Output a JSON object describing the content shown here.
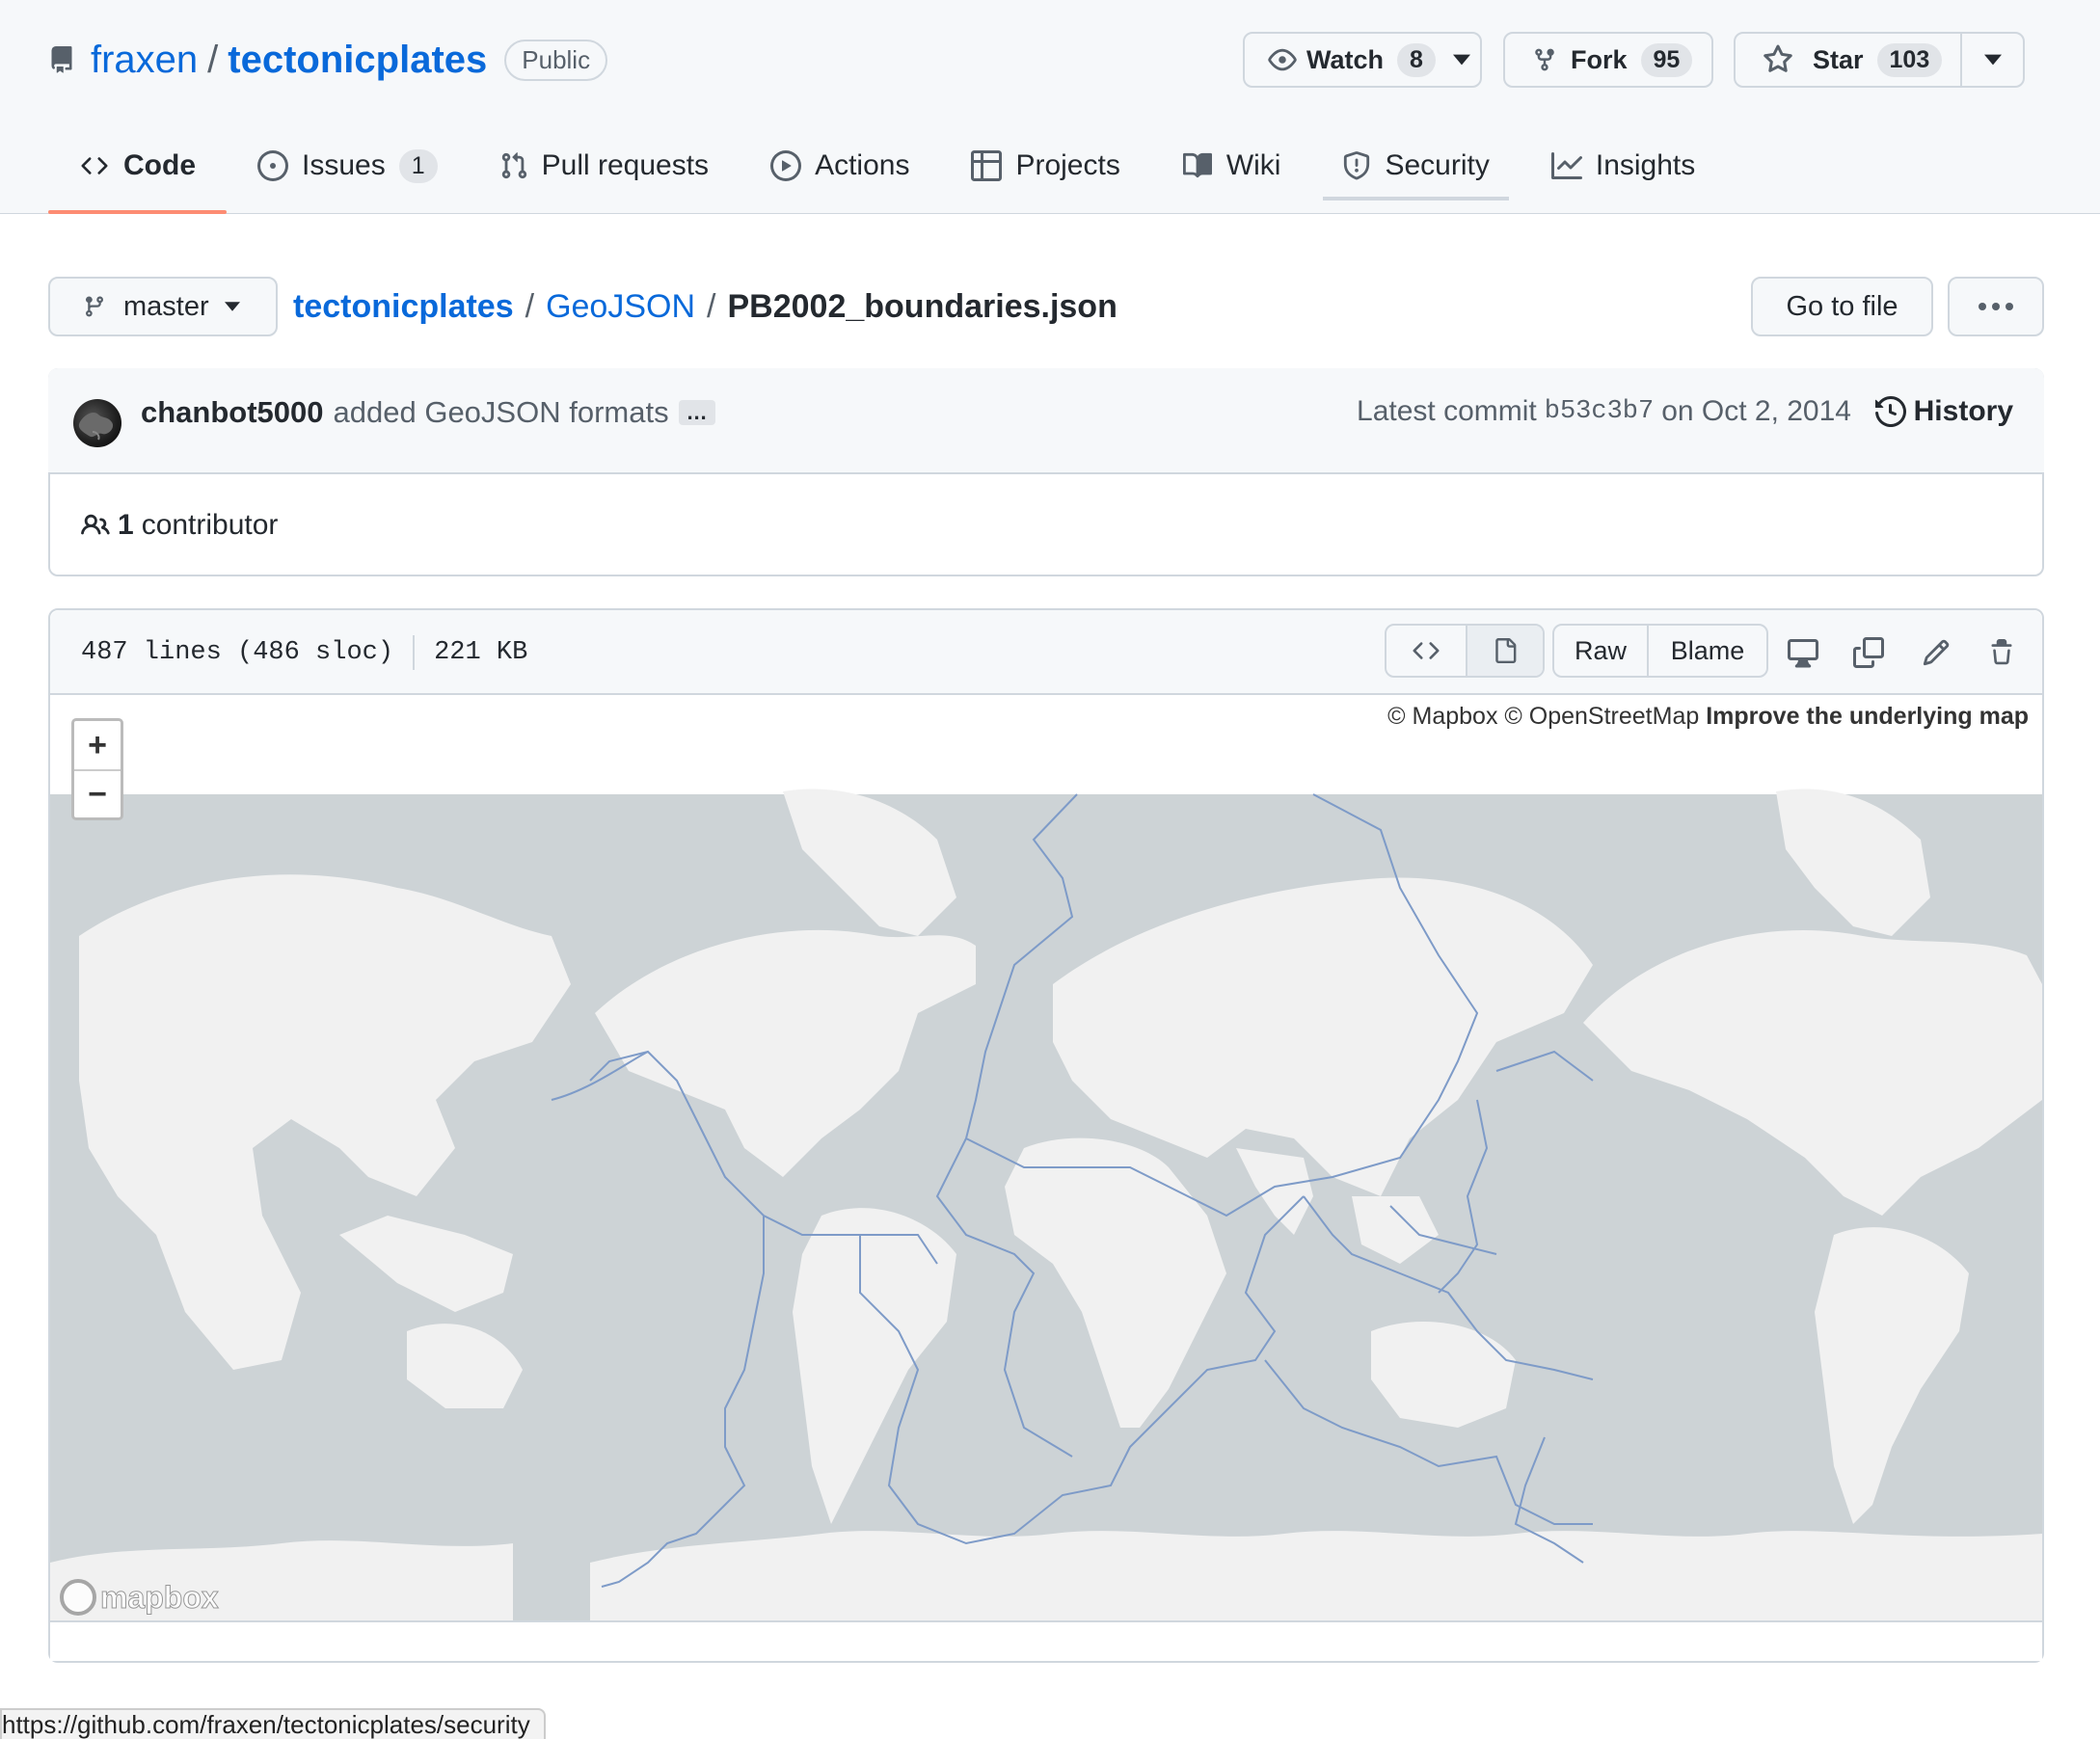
{
  "repo": {
    "owner": "fraxen",
    "name": "tectonicplates",
    "visibility": "Public"
  },
  "header_actions": {
    "watch": {
      "label": "Watch",
      "count": "8"
    },
    "fork": {
      "label": "Fork",
      "count": "95"
    },
    "star": {
      "label": "Star",
      "count": "103"
    }
  },
  "tabs": [
    {
      "label": "Code",
      "icon": "code-icon",
      "active": true
    },
    {
      "label": "Issues",
      "icon": "issue-icon",
      "count": "1"
    },
    {
      "label": "Pull requests",
      "icon": "pull-request-icon"
    },
    {
      "label": "Actions",
      "icon": "play-icon"
    },
    {
      "label": "Projects",
      "icon": "table-icon"
    },
    {
      "label": "Wiki",
      "icon": "book-icon"
    },
    {
      "label": "Security",
      "icon": "shield-icon"
    },
    {
      "label": "Insights",
      "icon": "graph-icon"
    }
  ],
  "file_nav": {
    "branch": "master",
    "breadcrumb": [
      "tectonicplates",
      "GeoJSON"
    ],
    "filename": "PB2002_boundaries.json",
    "go_to_file": "Go to file",
    "more": "···"
  },
  "commit": {
    "author": "chanbot5000",
    "message": "added GeoJSON formats",
    "ellipsis": "…",
    "latest_label": "Latest commit",
    "sha": "b53c3b7",
    "date": "on Oct 2, 2014",
    "history": "History",
    "contributors_count": "1",
    "contributors_label": "contributor"
  },
  "file_header": {
    "lines": "487 lines (486 sloc)",
    "size": "221 KB",
    "raw": "Raw",
    "blame": "Blame"
  },
  "map": {
    "attribution_1": "© Mapbox © OpenStreetMap",
    "attribution_2": "Improve the underlying map",
    "zoom_in": "+",
    "zoom_out": "−",
    "logo": "mapbox",
    "colors": {
      "water": "#cdd3d6",
      "land": "#f1f1f1",
      "boundary": "#7e9bc8"
    }
  },
  "status_bar": {
    "url": "https://github.com/fraxen/tectonicplates/security"
  },
  "colors": {
    "link": "#0969da",
    "tab_underline": "#fd8c73",
    "border": "#d0d7de",
    "header_bg": "#f6f8fa"
  }
}
